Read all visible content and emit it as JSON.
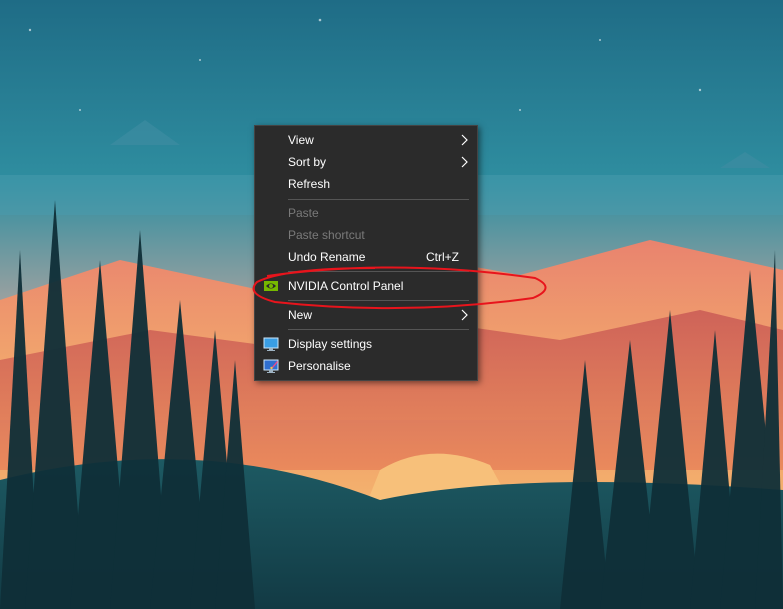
{
  "colors": {
    "menu_bg": "#2b2b2b",
    "menu_text": "#ffffff",
    "menu_disabled_text": "#7a7a7a",
    "annotation": "#e8141c",
    "nvidia_green": "#76b900"
  },
  "context_menu": {
    "items": [
      {
        "label": "View",
        "submenu": true
      },
      {
        "label": "Sort by",
        "submenu": true
      },
      {
        "label": "Refresh"
      },
      {
        "label": "Paste",
        "disabled": true
      },
      {
        "label": "Paste shortcut",
        "disabled": true
      },
      {
        "label": "Undo Rename",
        "shortcut": "Ctrl+Z"
      },
      {
        "label": "NVIDIA Control Panel",
        "icon": "nvidia-icon"
      },
      {
        "label": "New",
        "submenu": true
      },
      {
        "label": "Display settings",
        "icon": "display-icon"
      },
      {
        "label": "Personalise",
        "icon": "personalise-icon"
      }
    ]
  }
}
